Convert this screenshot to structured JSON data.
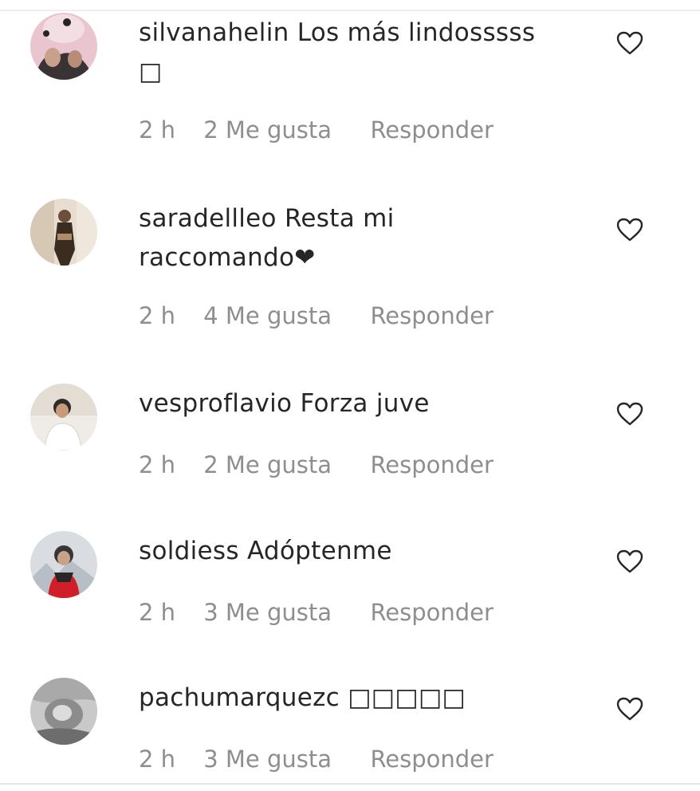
{
  "comments": [
    {
      "username": "silvanahelin",
      "text": "Los más lindosssss",
      "text_line2": "□",
      "time": "2 h",
      "likes": "2 Me gusta",
      "reply": "Responder"
    },
    {
      "username": "saradellleo",
      "text": "Resta mi",
      "text_line2": "raccomando❤",
      "time": "2 h",
      "likes": "4 Me gusta",
      "reply": "Responder"
    },
    {
      "username": "vesproflavio",
      "text": "Forza juve",
      "time": "2 h",
      "likes": "2 Me gusta",
      "reply": "Responder"
    },
    {
      "username": "soldiess",
      "text": "Adóptenme",
      "time": "2 h",
      "likes": "3 Me gusta",
      "reply": "Responder"
    },
    {
      "username": "pachumarquezc",
      "text": "□□□□□",
      "time": "2 h",
      "likes": "3 Me gusta",
      "reply": "Responder"
    }
  ],
  "icons": {
    "like": "heart-outline-icon"
  },
  "colors": {
    "text": "#262626",
    "meta": "#8e8e8e"
  }
}
